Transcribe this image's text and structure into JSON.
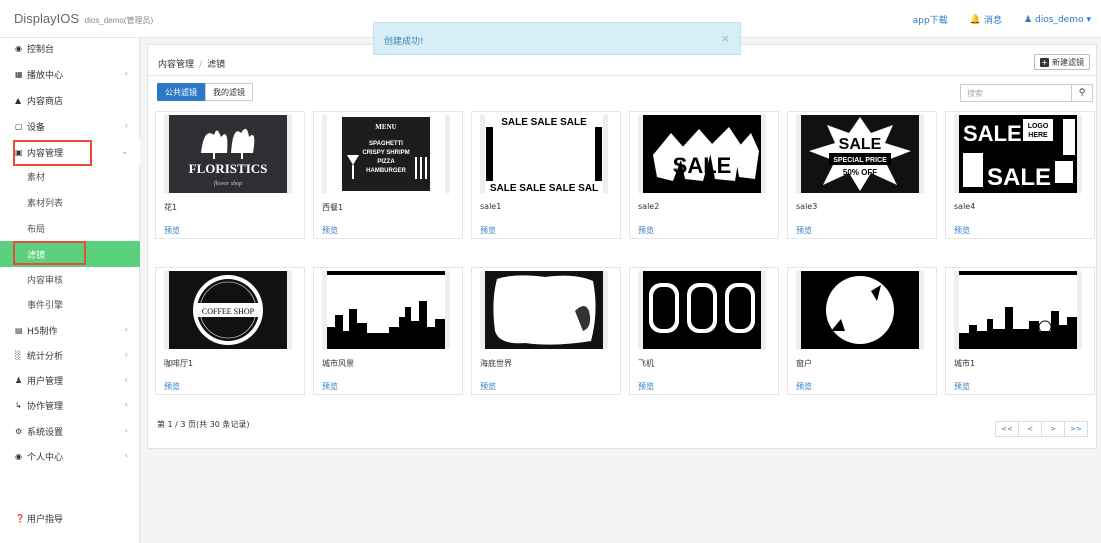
{
  "header": {
    "brand": "DisplayIOS",
    "brand_sub": "dios_demo(管理员)",
    "app_download": "app下载",
    "messages": "消息",
    "user": "dios_demo"
  },
  "toast": {
    "text": "创建成功!",
    "close": "×"
  },
  "sidebar": {
    "items": [
      {
        "label": "控制台",
        "icon": "dashboard-icon"
      },
      {
        "label": "播放中心",
        "icon": "grid-icon"
      },
      {
        "label": "内容商店",
        "icon": "bank-icon"
      },
      {
        "label": "设备",
        "icon": "monitor-icon"
      },
      {
        "label": "内容管理",
        "icon": "copy-icon"
      },
      {
        "label": "素材"
      },
      {
        "label": "素材列表"
      },
      {
        "label": "布局"
      },
      {
        "label": "滤镜"
      },
      {
        "label": "内容审核"
      },
      {
        "label": "事件引擎"
      },
      {
        "label": "H5制作",
        "icon": "h5-icon"
      },
      {
        "label": "统计分析",
        "icon": "chart-icon"
      },
      {
        "label": "用户管理",
        "icon": "users-icon"
      },
      {
        "label": "协作管理",
        "icon": "share-icon"
      },
      {
        "label": "系统设置",
        "icon": "gear-icon"
      },
      {
        "label": "个人中心",
        "icon": "user-circle-icon"
      },
      {
        "label": "用户指导",
        "icon": "question-icon"
      }
    ]
  },
  "main": {
    "breadcrumb": [
      "内容管理",
      "滤镜"
    ],
    "new_button": "新建滤镜",
    "tabs": [
      "公共滤镜",
      "我的滤镜"
    ],
    "search_placeholder": "搜索",
    "preview_label": "预览",
    "cards": [
      {
        "name": "花1",
        "thumb_text": "FLORISTICS"
      },
      {
        "name": "西餐1",
        "thumb_text": "MENU"
      },
      {
        "name": "sale1",
        "thumb_text": "SALE SALE SALE"
      },
      {
        "name": "sale2",
        "thumb_text": "SALE"
      },
      {
        "name": "sale3",
        "thumb_text": "SALE"
      },
      {
        "name": "sale4",
        "thumb_text": "SALE"
      },
      {
        "name": "咖啡厅1",
        "thumb_text": "COFFEE SHOP"
      },
      {
        "name": "城市风景",
        "thumb_text": ""
      },
      {
        "name": "海底世界",
        "thumb_text": ""
      },
      {
        "name": "飞机",
        "thumb_text": ""
      },
      {
        "name": "窗户",
        "thumb_text": ""
      },
      {
        "name": "城市1",
        "thumb_text": ""
      }
    ],
    "pager_text": "第 1 / 3 页(共 30 条记录)",
    "pager_buttons": [
      "<<",
      "<",
      ">",
      ">>"
    ]
  },
  "colors": {
    "primary": "#2c78c5",
    "active_nav": "#5bd07d",
    "highlight": "#e74c3c"
  }
}
